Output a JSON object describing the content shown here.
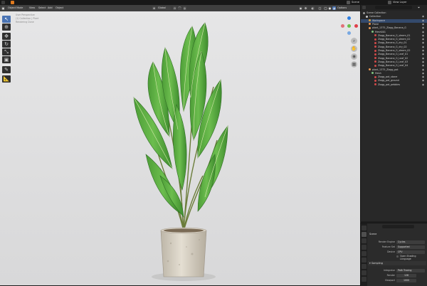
{
  "topbar": {
    "scene_label": "Scene",
    "view_layer_label": "View Layer"
  },
  "viewport": {
    "header": {
      "mode": "Object Mode",
      "menus": [
        "View",
        "Select",
        "Add",
        "Object"
      ],
      "transform_orientation": "Global",
      "options_label": "Options"
    },
    "info_lines": [
      "User Perspective",
      "(1) Collection | Plant",
      "Rendering Done"
    ]
  },
  "outliner": {
    "search_placeholder": "",
    "rows": [
      {
        "label": "Scene Collection",
        "indent": 0,
        "color": "#9a9a9a",
        "selected": false
      },
      {
        "label": "Collection",
        "indent": 1,
        "color": "#cccccc",
        "selected": false
      },
      {
        "label": "Workspace",
        "indent": 2,
        "color": "#d9a13b",
        "selected": true
      },
      {
        "label": "Plane",
        "indent": 2,
        "color": "#e79652",
        "selected": false
      },
      {
        "label": "plant_1375_Zlagg_Banana_G",
        "indent": 2,
        "color": "#e79652",
        "selected": false
      },
      {
        "label": "Mesh001",
        "indent": 3,
        "color": "#7fc47f",
        "selected": false
      },
      {
        "label": "Zlagg_Banana_G_steam_01",
        "indent": 4,
        "color": "#d04a4a",
        "selected": false
      },
      {
        "label": "Zlagg_Banana_G_steam_02",
        "indent": 4,
        "color": "#d04a4a",
        "selected": false
      },
      {
        "label": "Zlagg_Banana_G_dry_01",
        "indent": 4,
        "color": "#d04a4a",
        "selected": false
      },
      {
        "label": "Zlagg_Banana_G_dry_02",
        "indent": 4,
        "color": "#d04a4a",
        "selected": false
      },
      {
        "label": "Zlagg_Banana_G_steam_02",
        "indent": 4,
        "color": "#d04a4a",
        "selected": false
      },
      {
        "label": "Zlagg_Banana_G_Leaf_01",
        "indent": 4,
        "color": "#d04a4a",
        "selected": false
      },
      {
        "label": "Zlagg_Banana_G_Leaf_02",
        "indent": 4,
        "color": "#d04a4a",
        "selected": false
      },
      {
        "label": "Zlagg_Banana_G_Leaf_03",
        "indent": 4,
        "color": "#d04a4a",
        "selected": false
      },
      {
        "label": "Zlagg_Banana_G_Leaf_04",
        "indent": 4,
        "color": "#d04a4a",
        "selected": false
      },
      {
        "label": "plant_1375_Zlagg_pot",
        "indent": 2,
        "color": "#e79652",
        "selected": false
      },
      {
        "label": "Mesh",
        "indent": 3,
        "color": "#7fc47f",
        "selected": false
      },
      {
        "label": "Zlagg_pot_stone",
        "indent": 4,
        "color": "#d04a4a",
        "selected": false
      },
      {
        "label": "Zlagg_pot_ground",
        "indent": 4,
        "color": "#d04a4a",
        "selected": false
      },
      {
        "label": "Zlagg_pot_pebbles",
        "indent": 4,
        "color": "#d04a4a",
        "selected": false
      }
    ]
  },
  "properties": {
    "panel_title": "Scene",
    "render_engine_label": "Render Engine",
    "render_engine_value": "Cycles",
    "feature_set_label": "Feature Set",
    "feature_set_value": "Supported",
    "device_label": "Device",
    "device_value": "CPU",
    "osl_label": "Open Shading Language",
    "sampling_label": "Sampling",
    "integrator_label": "Integrator",
    "integrator_value": "Path Tracing",
    "render_label": "Render",
    "render_value": "128",
    "viewport_label": "Viewport",
    "viewport_value": "1000"
  }
}
